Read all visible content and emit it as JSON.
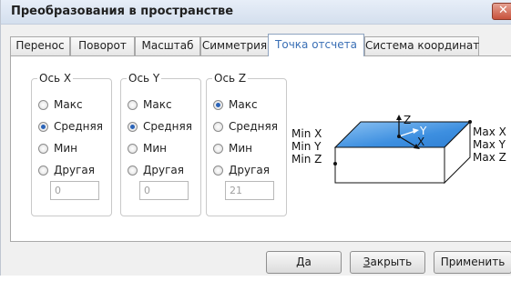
{
  "window": {
    "title": "Преобразования в пространстве",
    "close_glyph": "✕"
  },
  "tabs": [
    {
      "label": "Перенос"
    },
    {
      "label": "Поворот"
    },
    {
      "label": "Масштаб"
    },
    {
      "label": "Симметрия"
    },
    {
      "label": "Точка отсчета",
      "active": true
    },
    {
      "label": "Система координат"
    }
  ],
  "groups": [
    {
      "label": "Ось X",
      "options": [
        "Макс",
        "Средняя",
        "Мин",
        "Другая"
      ],
      "selected": "Средняя",
      "value": "0"
    },
    {
      "label": "Ось Y",
      "options": [
        "Макс",
        "Средняя",
        "Мин",
        "Другая"
      ],
      "selected": "Средняя",
      "value": "0"
    },
    {
      "label": "Ось Z",
      "options": [
        "Макс",
        "Средняя",
        "Мин",
        "Другая"
      ],
      "selected": "Макс",
      "value": "21"
    }
  ],
  "diagram": {
    "left_labels": [
      "Min X",
      "Min Y",
      "Min Z"
    ],
    "right_labels": [
      "Max X",
      "Max Y",
      "Max Z"
    ],
    "axis_z": "Z",
    "axis_y": "Y",
    "axis_x": "X",
    "colors": {
      "top_face": "#3d8fe0",
      "top_face_light": "#8cc2f2",
      "edges": "#111111"
    }
  },
  "buttons": {
    "ok": {
      "underline": "Д",
      "rest": "а"
    },
    "close": {
      "underline": "З",
      "rest": "акрыть"
    },
    "apply": {
      "underline": "",
      "rest": "Применить"
    }
  }
}
